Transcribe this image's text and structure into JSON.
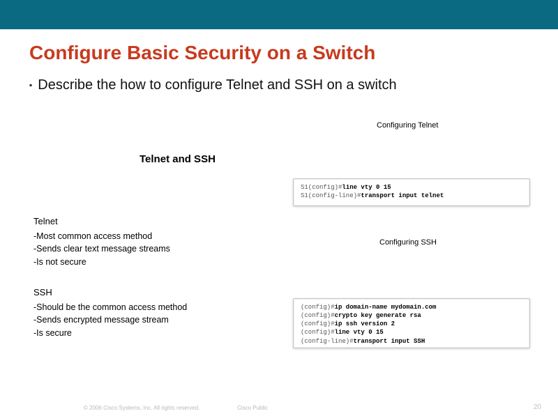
{
  "header": {
    "title": "Configure Basic Security on a Switch"
  },
  "bullet": {
    "marker": "▪",
    "text": "Describe the how to configure Telnet and SSH on a switch"
  },
  "subheading": "Telnet and SSH",
  "telnet": {
    "title": "Telnet",
    "lines": [
      "-Most common access method",
      "-Sends clear text message streams",
      "-Is not secure"
    ]
  },
  "ssh": {
    "title": "SSH",
    "lines": [
      "-Should be the common access method",
      "-Sends encrypted message stream",
      "-Is secure"
    ]
  },
  "config_telnet": {
    "caption": "Configuring Telnet",
    "rows": [
      {
        "prompt": "S1(config)#",
        "cmd": "line vty 0 15"
      },
      {
        "prompt": "S1(config-line)#",
        "cmd": "transport input telnet"
      }
    ]
  },
  "config_ssh": {
    "caption": "Configuring SSH",
    "rows": [
      {
        "prompt": "(config)#",
        "cmd": "ip domain-name mydomain.com"
      },
      {
        "prompt": "(config)#",
        "cmd": "crypto key generate rsa"
      },
      {
        "prompt": "(config)#",
        "cmd": "ip ssh version 2"
      },
      {
        "prompt": "(config)#",
        "cmd": "line vty 0 15"
      },
      {
        "prompt": "(config-line)#",
        "cmd": "transport input SSH"
      }
    ]
  },
  "footer": {
    "copyright": "© 2006 Cisco Systems, Inc. All rights reserved.",
    "classification": "Cisco Public",
    "page": "20"
  }
}
